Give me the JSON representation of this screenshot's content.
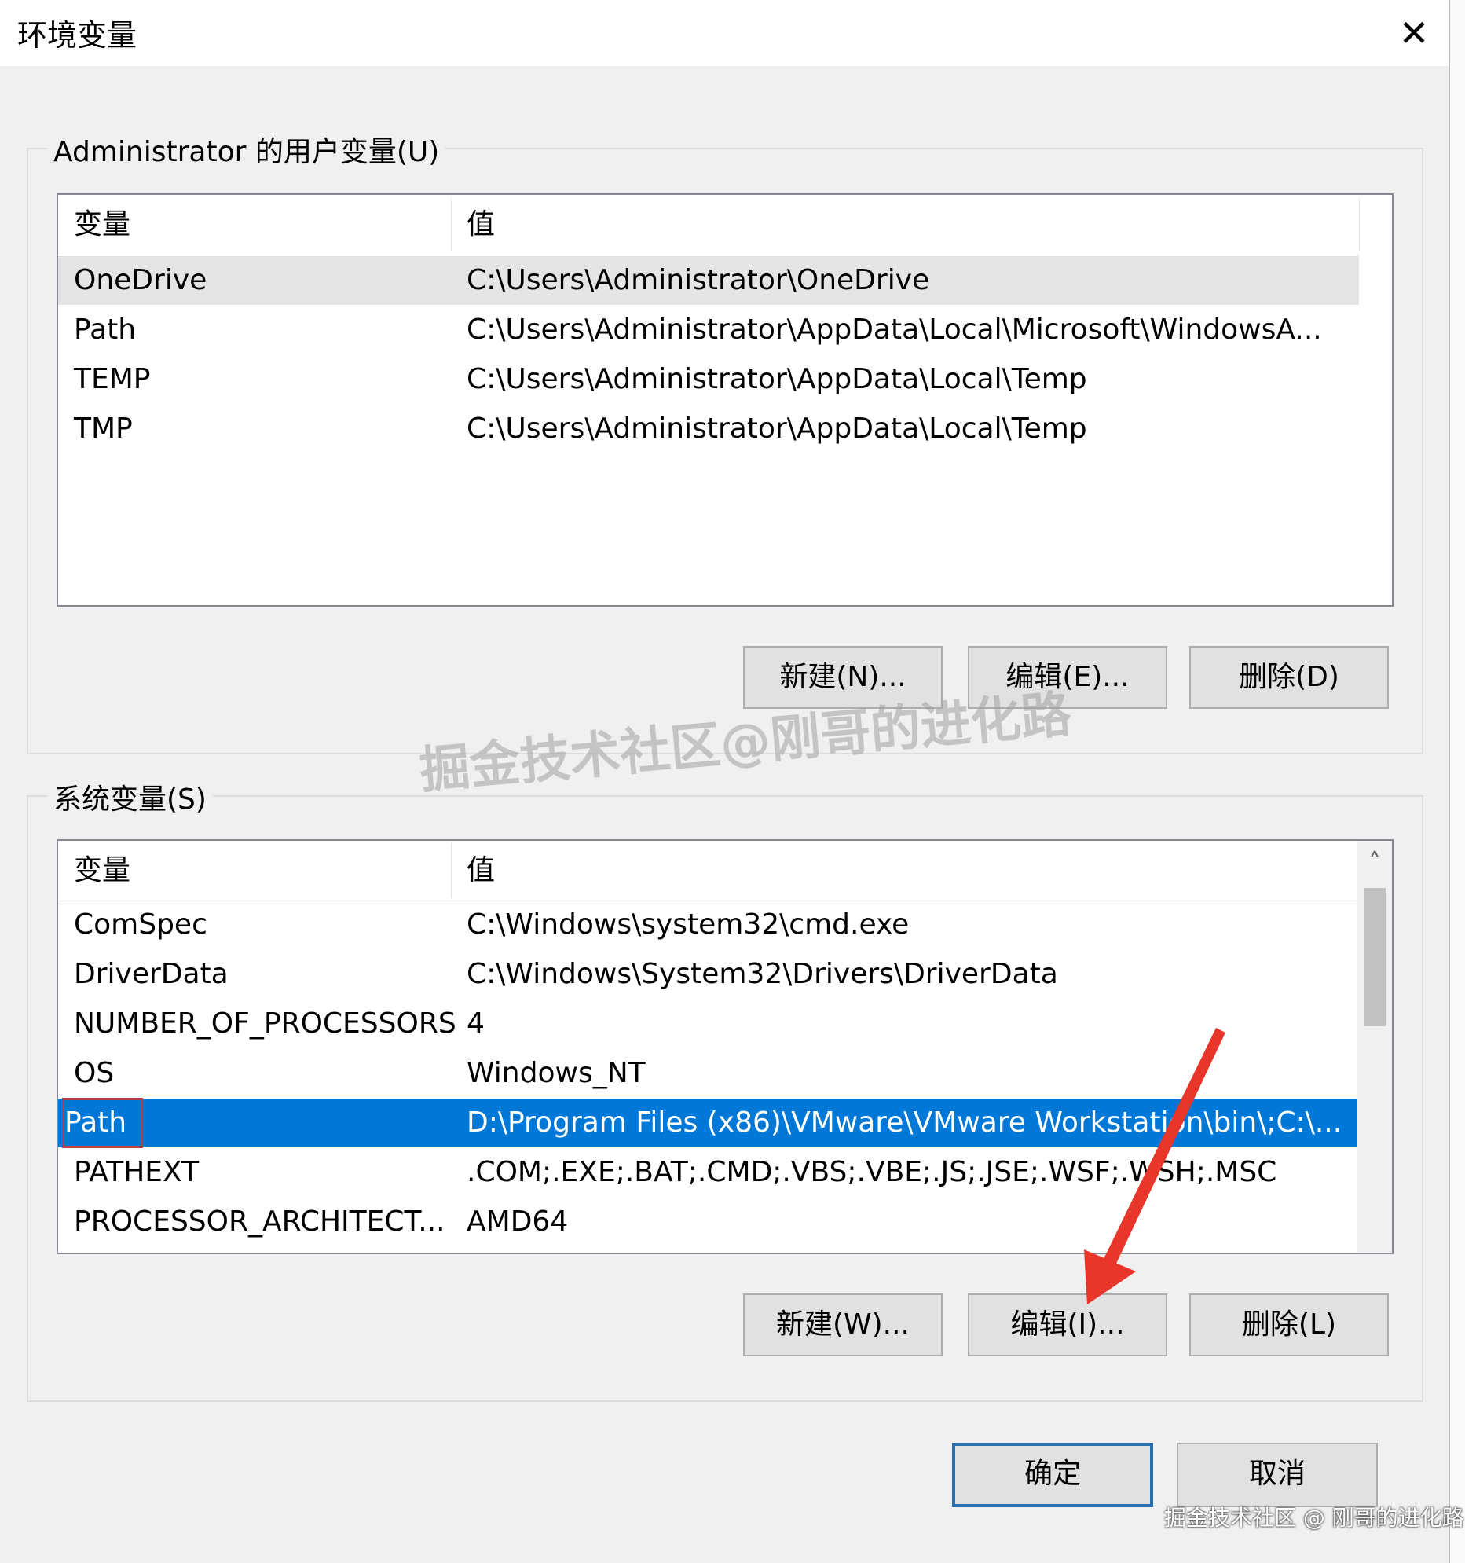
{
  "window": {
    "title": "环境变量",
    "close_glyph": "✕"
  },
  "user_vars": {
    "group_label": "Administrator 的用户变量(U)",
    "col_variable": "变量",
    "col_value": "值",
    "rows": [
      {
        "name": "OneDrive",
        "value": "C:\\Users\\Administrator\\OneDrive"
      },
      {
        "name": "Path",
        "value": "C:\\Users\\Administrator\\AppData\\Local\\Microsoft\\WindowsA..."
      },
      {
        "name": "TEMP",
        "value": "C:\\Users\\Administrator\\AppData\\Local\\Temp"
      },
      {
        "name": "TMP",
        "value": "C:\\Users\\Administrator\\AppData\\Local\\Temp"
      }
    ],
    "buttons": {
      "new": "新建(N)...",
      "edit": "编辑(E)...",
      "delete": "删除(D)"
    }
  },
  "system_vars": {
    "group_label": "系统变量(S)",
    "col_variable": "变量",
    "col_value": "值",
    "rows": [
      {
        "name": "ComSpec",
        "value": "C:\\Windows\\system32\\cmd.exe"
      },
      {
        "name": "DriverData",
        "value": "C:\\Windows\\System32\\Drivers\\DriverData"
      },
      {
        "name": "NUMBER_OF_PROCESSORS",
        "value": "4"
      },
      {
        "name": "OS",
        "value": "Windows_NT"
      },
      {
        "name": "Path",
        "value": "D:\\Program Files (x86)\\VMware\\VMware Workstation\\bin\\;C:\\..."
      },
      {
        "name": "PATHEXT",
        "value": ".COM;.EXE;.BAT;.CMD;.VBS;.VBE;.JS;.JSE;.WSF;.WSH;.MSC"
      },
      {
        "name": "PROCESSOR_ARCHITECT...",
        "value": "AMD64"
      }
    ],
    "scroll_up_glyph": "˄",
    "buttons": {
      "new": "新建(W)...",
      "edit": "编辑(I)...",
      "delete": "删除(L)"
    }
  },
  "footer": {
    "ok": "确定",
    "cancel": "取消"
  },
  "watermark": {
    "center": "掘金技术社区@刚哥的进化路",
    "corner": "掘金技术社区 @ 刚哥的进化路"
  },
  "colors": {
    "selection": "#0078d7",
    "highlight_box": "#c23a4a",
    "arrow": "#e8372a"
  }
}
